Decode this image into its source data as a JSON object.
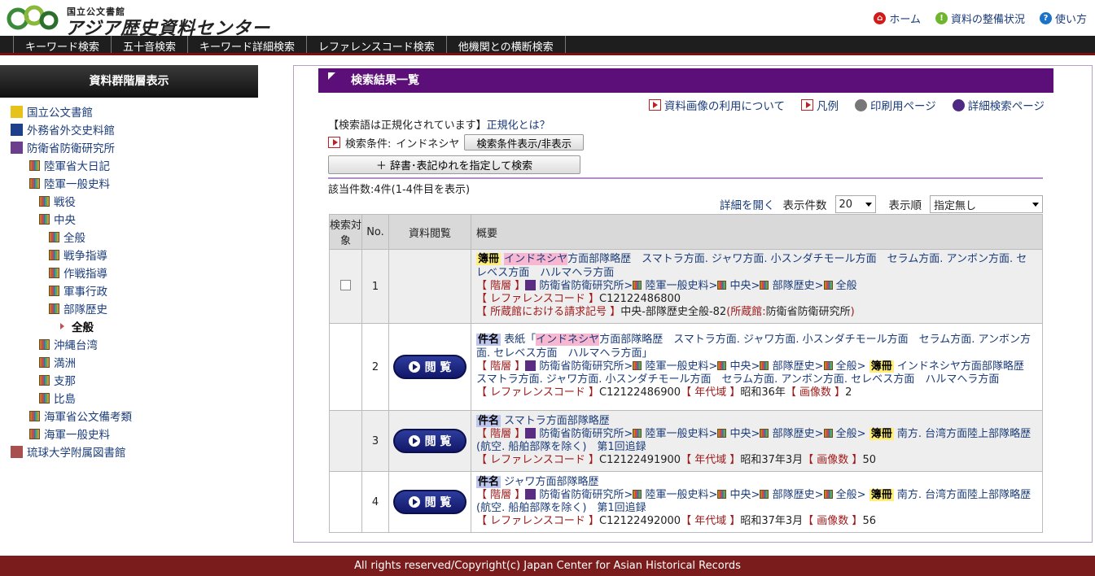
{
  "header": {
    "logo_sub": "国立公文書館",
    "logo_main": "アジア歴史資料センター",
    "links": [
      {
        "label": "ホーム",
        "icon": "home-icon",
        "color": "#d21a1a"
      },
      {
        "label": "資料の整備状況",
        "icon": "info-icon",
        "color": "#6fb62c"
      },
      {
        "label": "使い方",
        "icon": "help-icon",
        "color": "#1b73c8"
      }
    ]
  },
  "nav": [
    "キーワード検索",
    "五十音検索",
    "キーワード詳細検索",
    "レファレンスコード検索",
    "他機関との横断検索"
  ],
  "sidebar": {
    "title": "資料群階層表示",
    "items": [
      {
        "label": "国立公文書館",
        "color": "#e6c21a"
      },
      {
        "label": "外務省外交史料館",
        "color": "#1d3f8c"
      },
      {
        "label": "防衛省防衛研究所",
        "color": "#6c3e8e"
      },
      {
        "label": "陸軍省大日記"
      },
      {
        "label": "陸軍一般史料"
      },
      {
        "label": "戦役"
      },
      {
        "label": "中央"
      },
      {
        "label": "全般"
      },
      {
        "label": "戦争指導"
      },
      {
        "label": "作戦指導"
      },
      {
        "label": "軍事行政"
      },
      {
        "label": "部隊歴史"
      },
      {
        "label": "全般"
      },
      {
        "label": "沖縄台湾"
      },
      {
        "label": "満洲"
      },
      {
        "label": "支那"
      },
      {
        "label": "比島"
      },
      {
        "label": "海軍省公文備考類"
      },
      {
        "label": "海軍一般史料"
      },
      {
        "label": "琉球大学附属図書館",
        "color": "#a85050"
      }
    ]
  },
  "main": {
    "title": "検索結果一覧",
    "links": [
      "資料画像の利用について",
      "凡例",
      "印刷用ページ",
      "詳細検索ページ"
    ],
    "normalize_note": "【検索語は正規化されています】",
    "normalize_link": "正規化とは？",
    "cond_label": "検索条件:",
    "cond_value": "インドネシヤ",
    "toggle_btn": "検索条件表示/非表示",
    "dict_btn": "＋ 辞書･表記ゆれを指定して検索",
    "count": "該当件数:4件(1-4件目を表示)",
    "detail_link": "詳細を開く",
    "per_page_label": "表示件数",
    "per_page_value": "20",
    "order_label": "表示順",
    "order_value": "指定無し",
    "columns": [
      "検索対象",
      "No.",
      "資料閲覧",
      "概要"
    ],
    "view_label": "閲 覧",
    "rows": [
      {
        "no": "1",
        "tag": "簿冊",
        "pre": "",
        "hl": "インドネシヤ",
        "title_rest": "方面部隊略歴　スマトラ方面. ジャワ方面. 小スンダチモール方面　セラム方面. アンボン方面. セレベス方面　ハルマヘラ方面",
        "hier_label": "【 階層 】",
        "hier": [
          "防衛省防衛研究所",
          "陸軍一般史料",
          "中央",
          "部隊歴史",
          "全般"
        ],
        "ref_label": "【 レファレンスコード 】",
        "ref": "C12122486800",
        "call_label": "【 所蔵館における請求記号 】",
        "call": "中央-部隊歴史全般-82",
        "call_org_prefix": "(所蔵館:",
        "call_org": "防衛省防衛研究所",
        "call_org_suffix": ")"
      },
      {
        "no": "2",
        "tag": "件名",
        "pre": "表紙「",
        "hl": "インドネシヤ",
        "title_rest": "方面部隊略歴　スマトラ方面. ジャワ方面. 小スンダチモール方面　セラム方面. アンボン方面. セレベス方面　ハルマヘラ方面」",
        "hier_label": "【 階層 】",
        "hier": [
          "防衛省防衛研究所",
          "陸軍一般史料",
          "中央",
          "部隊歴史",
          "全般"
        ],
        "book_tag": "簿冊",
        "book": "インドネシヤ方面部隊略歴　スマトラ方面. ジャワ方面. 小スンダチモール方面　セラム方面. アンボン方面. セレベス方面　ハルマヘラ方面",
        "ref_label": "【 レファレンスコード 】",
        "ref": "C12122486900",
        "era_label": "【 年代域 】",
        "era": "昭和36年",
        "img_label": "【 画像数 】",
        "imgs": "2"
      },
      {
        "no": "3",
        "tag": "件名",
        "title": "スマトラ方面部隊略歴",
        "hier_label": "【 階層 】",
        "hier": [
          "防衛省防衛研究所",
          "陸軍一般史料",
          "中央",
          "部隊歴史",
          "全般"
        ],
        "book_tag": "簿冊",
        "book": "南方. 台湾方面陸上部隊略歴(航空. 船舶部隊を除く)　第1回追録",
        "ref_label": "【 レファレンスコード 】",
        "ref": "C12122491900",
        "era_label": "【 年代域 】",
        "era": "昭和37年3月",
        "img_label": "【 画像数 】",
        "imgs": "50"
      },
      {
        "no": "4",
        "tag": "件名",
        "title": "ジャワ方面部隊略歴",
        "hier_label": "【 階層 】",
        "hier": [
          "防衛省防衛研究所",
          "陸軍一般史料",
          "中央",
          "部隊歴史",
          "全般"
        ],
        "book_tag": "簿冊",
        "book": "南方. 台湾方面陸上部隊略歴(航空. 船舶部隊を除く)　第1回追録",
        "ref_label": "【 レファレンスコード 】",
        "ref": "C12122492000",
        "era_label": "【 年代域 】",
        "era": "昭和37年3月",
        "img_label": "【 画像数 】",
        "imgs": "56"
      }
    ]
  },
  "footer": "All rights reserved/Copyright(c) Japan Center for Asian Historical Records"
}
